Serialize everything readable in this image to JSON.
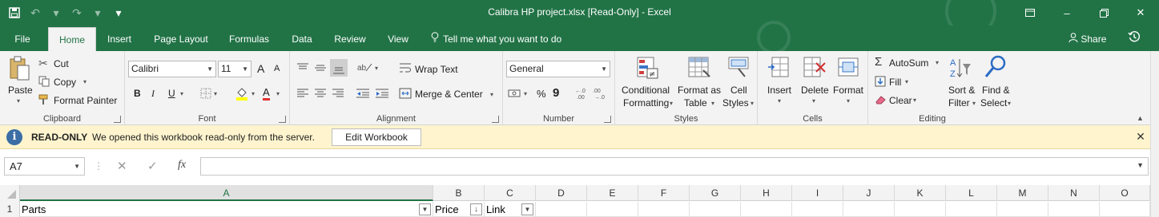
{
  "title_bar": {
    "title": "Calibra HP project.xlsx  [Read-Only]  -  Excel",
    "qat_icons": [
      "save-icon",
      "undo-icon",
      "redo-icon",
      "customize-icon"
    ],
    "window_controls": [
      "ribbon-display-icon",
      "minimize-icon",
      "restore-icon",
      "close-icon"
    ]
  },
  "tabs": [
    {
      "label": "File",
      "active": false
    },
    {
      "label": "Home",
      "active": true
    },
    {
      "label": "Insert",
      "active": false
    },
    {
      "label": "Page Layout",
      "active": false
    },
    {
      "label": "Formulas",
      "active": false
    },
    {
      "label": "Data",
      "active": false
    },
    {
      "label": "Review",
      "active": false
    },
    {
      "label": "View",
      "active": false
    }
  ],
  "tell_me": "Tell me what you want to do",
  "share_label": "Share",
  "ribbon": {
    "clipboard": {
      "label": "Clipboard",
      "paste": "Paste",
      "cut": "Cut",
      "copy": "Copy",
      "format_painter": "Format Painter"
    },
    "font": {
      "label": "Font",
      "font_name": "Calibri",
      "font_size": "11",
      "bold": "B",
      "italic": "I",
      "underline": "U",
      "grow": "A",
      "shrink": "A",
      "font_color": "A"
    },
    "alignment": {
      "label": "Alignment",
      "wrap_text": "Wrap Text",
      "merge_center": "Merge & Center"
    },
    "number": {
      "label": "Number",
      "format": "General",
      "percent": "%",
      "comma": "9"
    },
    "styles": {
      "label": "Styles",
      "conditional_1": "Conditional",
      "conditional_2": "Formatting",
      "format_table_1": "Format as",
      "format_table_2": "Table",
      "cell_styles_1": "Cell",
      "cell_styles_2": "Styles"
    },
    "cells": {
      "label": "Cells",
      "insert": "Insert",
      "delete": "Delete",
      "format": "Format"
    },
    "editing": {
      "label": "Editing",
      "autosum": "AutoSum",
      "fill": "Fill",
      "clear": "Clear",
      "sort_1": "Sort &",
      "sort_2": "Filter",
      "find_1": "Find &",
      "find_2": "Select"
    }
  },
  "info_bar": {
    "status": "READ-ONLY",
    "message": "We opened this workbook read-only from the server.",
    "button": "Edit Workbook"
  },
  "formula_bar": {
    "name_box": "A7",
    "formula": "",
    "fx": "fx"
  },
  "grid": {
    "columns": [
      "A",
      "B",
      "C",
      "D",
      "E",
      "F",
      "G",
      "H",
      "I",
      "J",
      "K",
      "L",
      "M",
      "N",
      "O"
    ],
    "selected_column": "A",
    "rows": [
      {
        "row": "1",
        "cells": [
          "Parts",
          "Price",
          "Link"
        ]
      }
    ]
  },
  "colors": {
    "brand_green": "#217346",
    "info_bar": "#fff4ce"
  }
}
